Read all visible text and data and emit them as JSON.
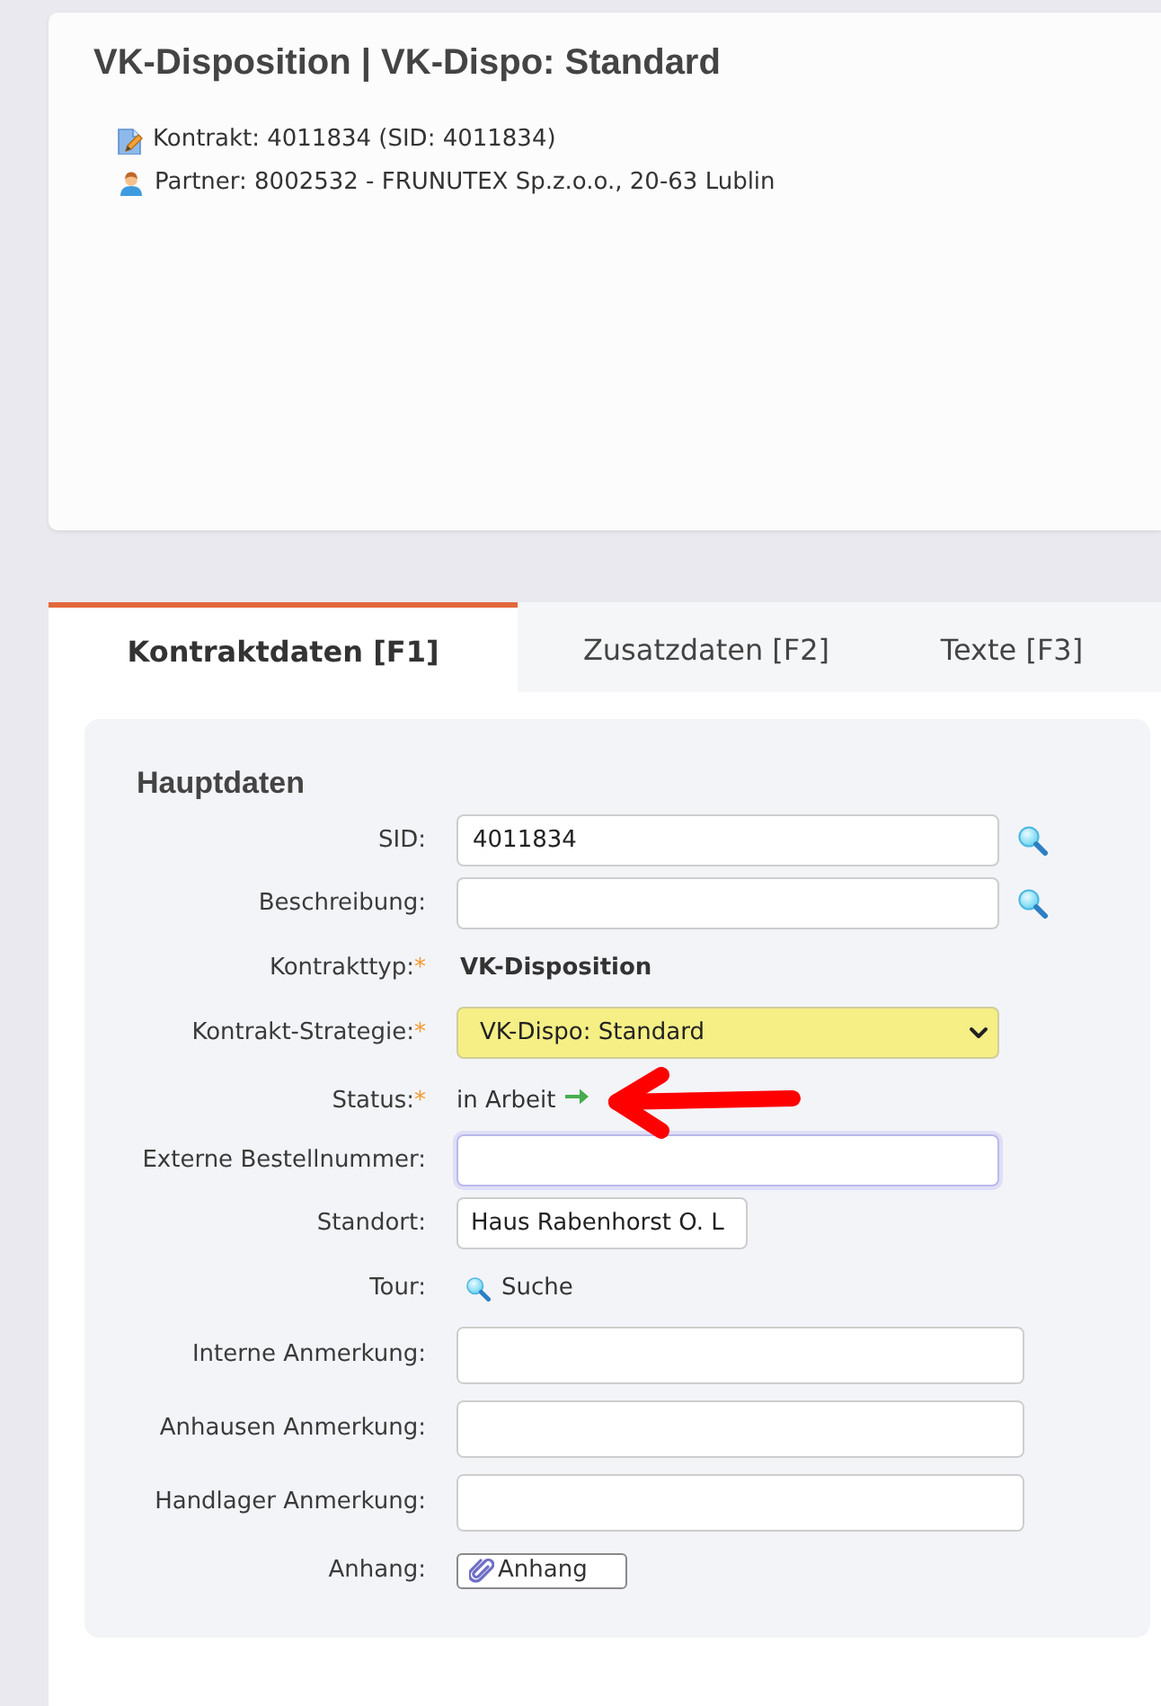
{
  "header": {
    "title": "VK-Disposition | VK-Dispo: Standard",
    "info": [
      {
        "kind": "contract",
        "text": "Kontrakt: 4011834 (SID: 4011834)"
      },
      {
        "kind": "partner",
        "text": "Partner: 8002532 - FRUNUTEX Sp.z.o.o., 20-63 Lublin"
      }
    ]
  },
  "tabs": [
    {
      "label": "Kontraktdaten [F1]",
      "selected": true
    },
    {
      "label": "Zusatzdaten [F2]",
      "selected": false
    },
    {
      "label": "Texte [F3]",
      "selected": false
    }
  ],
  "section": {
    "title": "Hauptdaten",
    "fields": [
      {
        "kind": "input",
        "label": "SID:",
        "value": "4011834",
        "focused": false,
        "short": false,
        "lookup": true,
        "highlighted": false
      },
      {
        "kind": "input",
        "label": "Beschreibung:",
        "focused": false,
        "short": false,
        "lookup": true,
        "highlighted": false
      },
      {
        "kind": "text",
        "label": "Kontrakttyp:",
        "required_mark": "*",
        "value": "VK-Disposition",
        "highlighted": false
      },
      {
        "kind": "select",
        "label": "Kontrakt-Strategie:",
        "required_mark": "*",
        "value": "VK-Dispo: Standard",
        "highlighted": false
      },
      {
        "kind": "status",
        "label": "Status:",
        "required_mark": "*",
        "value": "in Arbeit",
        "highlighted": true
      },
      {
        "kind": "input",
        "label": "Externe Bestellnummer:",
        "focused": true,
        "short": false,
        "lookup": false,
        "highlighted": false
      },
      {
        "kind": "input",
        "label": "Standort:",
        "value": "Haus Rabenhorst O. L",
        "focused": false,
        "short": true,
        "lookup": false,
        "highlighted": false
      },
      {
        "kind": "link",
        "label": "Tour:",
        "value": "Suche",
        "highlighted": false
      },
      {
        "kind": "textarea",
        "label": "Interne Anmerkung:",
        "focused": false,
        "highlighted": false
      },
      {
        "kind": "textarea",
        "label": "Anhausen Anmerkung:",
        "focused": false,
        "highlighted": false
      },
      {
        "kind": "textarea",
        "label": "Handlager Anmerkung:",
        "focused": false,
        "highlighted": false
      },
      {
        "kind": "button",
        "label": "Anhang:",
        "value": "Anhang",
        "highlighted": false
      }
    ]
  }
}
